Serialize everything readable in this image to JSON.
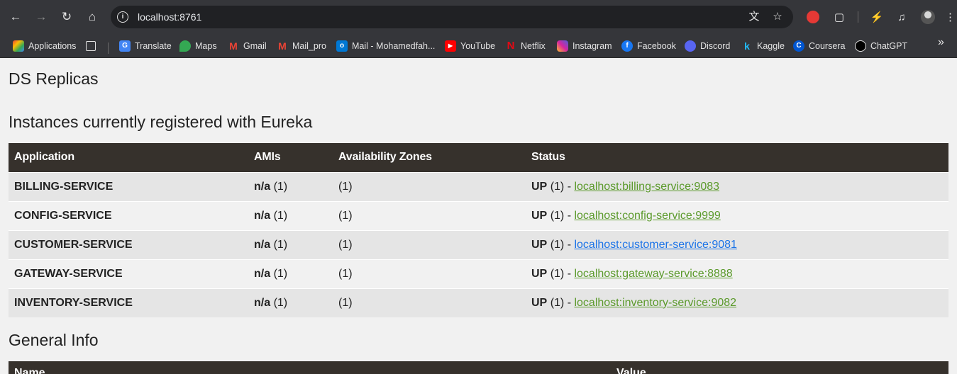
{
  "browser": {
    "url": "localhost:8761",
    "bookmarks": [
      {
        "label": "Applications",
        "icon": "apps-grid-icon",
        "color": "#ea4335"
      },
      {
        "label": "Translate",
        "icon": "translate-icon",
        "color": "#4285f4"
      },
      {
        "label": "Maps",
        "icon": "maps-icon",
        "color": "#34a853"
      },
      {
        "label": "Gmail",
        "icon": "gmail-icon",
        "color": "#ea4335"
      },
      {
        "label": "Mail_pro",
        "icon": "gmail-icon",
        "color": "#ea4335"
      },
      {
        "label": "Mail - Mohamedfah...",
        "icon": "outlook-icon",
        "color": "#0078d4"
      },
      {
        "label": "YouTube",
        "icon": "youtube-icon",
        "color": "#ff0000"
      },
      {
        "label": "Netflix",
        "icon": "netflix-icon",
        "color": "#e50914"
      },
      {
        "label": "Instagram",
        "icon": "instagram-icon",
        "color": "#d6249f"
      },
      {
        "label": "Facebook",
        "icon": "facebook-icon",
        "color": "#1877f2"
      },
      {
        "label": "Discord",
        "icon": "discord-icon",
        "color": "#5865f2"
      },
      {
        "label": "Kaggle",
        "icon": "kaggle-icon",
        "color": "#20beff"
      },
      {
        "label": "Coursera",
        "icon": "coursera-icon",
        "color": "#0056d2"
      },
      {
        "label": "ChatGPT",
        "icon": "chatgpt-icon",
        "color": "#000000"
      }
    ]
  },
  "page": {
    "title": "DS Replicas",
    "instances_heading": "Instances currently registered with Eureka",
    "general_heading": "General Info",
    "columns": [
      "Application",
      "AMIs",
      "Availability Zones",
      "Status"
    ],
    "general_columns": [
      "Name",
      "Value"
    ],
    "rows": [
      {
        "app": "BILLING-SERVICE",
        "ami": "n/a",
        "ami_count": "(1)",
        "zones": "(1)",
        "status": "UP",
        "status_count": "(1) -",
        "link": "localhost:billing-service:9083"
      },
      {
        "app": "CONFIG-SERVICE",
        "ami": "n/a",
        "ami_count": "(1)",
        "zones": "(1)",
        "status": "UP",
        "status_count": "(1) -",
        "link": "localhost:config-service:9999"
      },
      {
        "app": "CUSTOMER-SERVICE",
        "ami": "n/a",
        "ami_count": "(1)",
        "zones": "(1)",
        "status": "UP",
        "status_count": "(1) -",
        "link": "localhost:customer-service:9081"
      },
      {
        "app": "GATEWAY-SERVICE",
        "ami": "n/a",
        "ami_count": "(1)",
        "zones": "(1)",
        "status": "UP",
        "status_count": "(1) -",
        "link": "localhost:gateway-service:8888"
      },
      {
        "app": "INVENTORY-SERVICE",
        "ami": "n/a",
        "ami_count": "(1)",
        "zones": "(1)",
        "status": "UP",
        "status_count": "(1) -",
        "link": "localhost:inventory-service:9082"
      }
    ]
  }
}
